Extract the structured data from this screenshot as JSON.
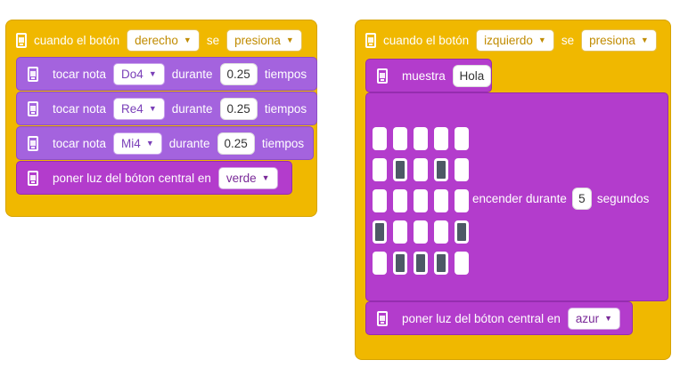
{
  "left_script": {
    "event": {
      "prefix": "cuando el botón",
      "button": "derecho",
      "connector": "se",
      "action": "presiona"
    },
    "notes": [
      {
        "label": "tocar nota",
        "note": "Do4",
        "during": "durante",
        "duration": "0.25",
        "unit": "tiempos"
      },
      {
        "label": "tocar nota",
        "note": "Re4",
        "during": "durante",
        "duration": "0.25",
        "unit": "tiempos"
      },
      {
        "label": "tocar nota",
        "note": "Mi4",
        "during": "durante",
        "duration": "0.25",
        "unit": "tiempos"
      }
    ],
    "light": {
      "label": "poner luz del bóton central en",
      "color": "verde"
    }
  },
  "right_script": {
    "event": {
      "prefix": "cuando el botón",
      "button": "izquierdo",
      "connector": "se",
      "action": "presiona"
    },
    "show": {
      "label": "muestra",
      "text": "Hola"
    },
    "matrix": {
      "rows": [
        [
          0,
          0,
          0,
          0,
          0
        ],
        [
          0,
          1,
          0,
          1,
          0
        ],
        [
          0,
          0,
          0,
          0,
          0
        ],
        [
          1,
          0,
          0,
          0,
          1
        ],
        [
          0,
          1,
          1,
          1,
          0
        ]
      ],
      "label": "encender durante",
      "seconds": "5",
      "unit": "segundos"
    },
    "light": {
      "label": "poner luz del bóton central en",
      "color": "azur"
    }
  },
  "colors": {
    "event_block": "#f0b800",
    "sound_block": "#a463de",
    "display_block": "#b33ccc",
    "led_on": "#4d5966"
  },
  "icons": {
    "block_icon": "microbit-device-icon",
    "dropdown_icon": "caret-down-icon"
  }
}
